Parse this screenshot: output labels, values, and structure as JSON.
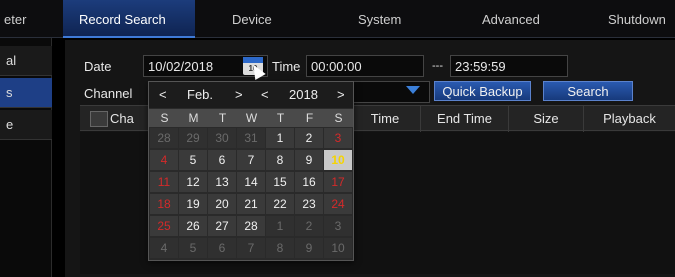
{
  "tabs": [
    {
      "label": "eter"
    },
    {
      "label": "Record Search",
      "active": true
    },
    {
      "label": "Device"
    },
    {
      "label": "System"
    },
    {
      "label": "Advanced"
    },
    {
      "label": "Shutdown"
    }
  ],
  "sidebar": {
    "items": [
      {
        "label": "al"
      },
      {
        "label": "s"
      },
      {
        "label": "e"
      }
    ]
  },
  "form": {
    "date_label": "Date",
    "date_value": "10/02/2018",
    "calendar_icon_text": "10",
    "time_label": "Time",
    "time_start": "00:00:00",
    "time_sep": "---",
    "time_end": "23:59:59",
    "channel_label": "Channel",
    "quick_backup_label": "Quick Backup",
    "search_label": "Search"
  },
  "table": {
    "headers": [
      "Cha",
      "Time",
      "End Time",
      "Size",
      "Playback"
    ]
  },
  "calendar": {
    "month": "Feb.",
    "year": "2018",
    "prev_month": "<",
    "next_month": ">",
    "prev_year": "<",
    "next_year": ">",
    "weekdays": [
      "S",
      "M",
      "T",
      "W",
      "T",
      "F",
      "S"
    ],
    "selected_day": "10",
    "weeks": [
      [
        "28",
        "29",
        "30",
        "31",
        "1",
        "2",
        "3"
      ],
      [
        "4",
        "5",
        "6",
        "7",
        "8",
        "9",
        "10"
      ],
      [
        "11",
        "12",
        "13",
        "14",
        "15",
        "16",
        "17"
      ],
      [
        "18",
        "19",
        "20",
        "21",
        "22",
        "23",
        "24"
      ],
      [
        "25",
        "26",
        "27",
        "28",
        "1",
        "2",
        "3"
      ],
      [
        "4",
        "5",
        "6",
        "7",
        "8",
        "9",
        "10"
      ]
    ],
    "other_month": [
      [
        true,
        true,
        true,
        true,
        false,
        false,
        false
      ],
      [
        false,
        false,
        false,
        false,
        false,
        false,
        false
      ],
      [
        false,
        false,
        false,
        false,
        false,
        false,
        false
      ],
      [
        false,
        false,
        false,
        false,
        false,
        false,
        false
      ],
      [
        false,
        false,
        false,
        false,
        true,
        true,
        true
      ],
      [
        true,
        true,
        true,
        true,
        true,
        true,
        true
      ]
    ]
  }
}
